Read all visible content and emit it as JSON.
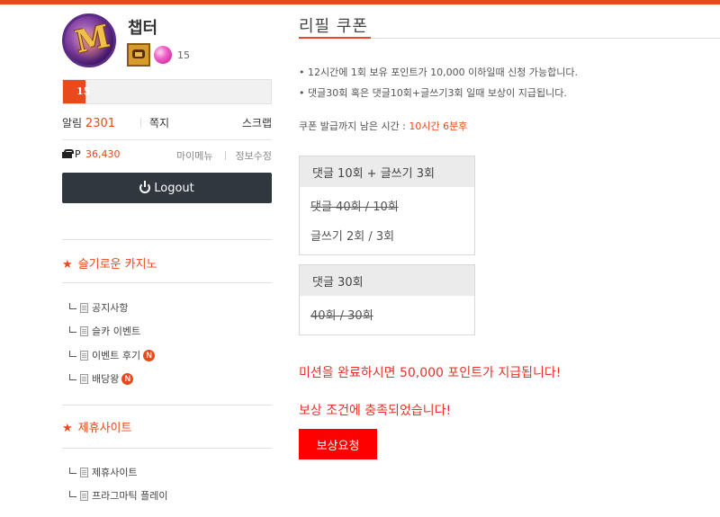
{
  "profile": {
    "nickname": "챕터",
    "gem_count": "15",
    "level": "15",
    "level_progress": 0.11,
    "alarm_label": "알림",
    "alarm_count": "2301",
    "message_label": "쪽지",
    "scrap_label": "스크랩",
    "points_prefix": "P",
    "points_value": "36,430",
    "my_menu_label": "마이메뉴",
    "edit_info_label": "정보수정",
    "logout_label": "Logout"
  },
  "sidebar": {
    "section1_title": "슬기로운 카지노",
    "section1_items": [
      {
        "label": "공지사항",
        "new": ""
      },
      {
        "label": "슬카 이벤트",
        "new": ""
      },
      {
        "label": "이벤트 후기",
        "new": "N"
      },
      {
        "label": "배당왕",
        "new": "N"
      }
    ],
    "section2_title": "제휴사이트",
    "section2_items": [
      {
        "label": "제휴사이트"
      },
      {
        "label": "프라그마틱 플레이"
      }
    ]
  },
  "main": {
    "title": "리필 쿠폰",
    "notice_1": "• 12시간에 1회 보유 포인트가 10,000 이하일때 신청 가능합니다.",
    "notice_2": "• 댓글30회 혹은 댓글10회+글쓰기3회 일때 보상이 지급됩니다.",
    "remain_label": "쿠폰 발급까지 남은 시간 :",
    "remain_time": "10시간 6분후",
    "box1": {
      "header": "댓글 10회 + 글쓰기 3회",
      "row1": "댓글 40회 / 10회",
      "row2": "글쓰기 2회 / 3회"
    },
    "box2": {
      "header": "댓글 30회",
      "row1": "40회 / 30회"
    },
    "mission_message": "미션을 완료하시면 50,000 포인트가 지급됩니다!",
    "condition_message": "보상 조건에 충족되었습니다!",
    "reward_button": "보상요청"
  },
  "colors": {
    "accent": "#e8491d",
    "alert_red": "#ff0000",
    "logout_bg": "#31373f"
  }
}
